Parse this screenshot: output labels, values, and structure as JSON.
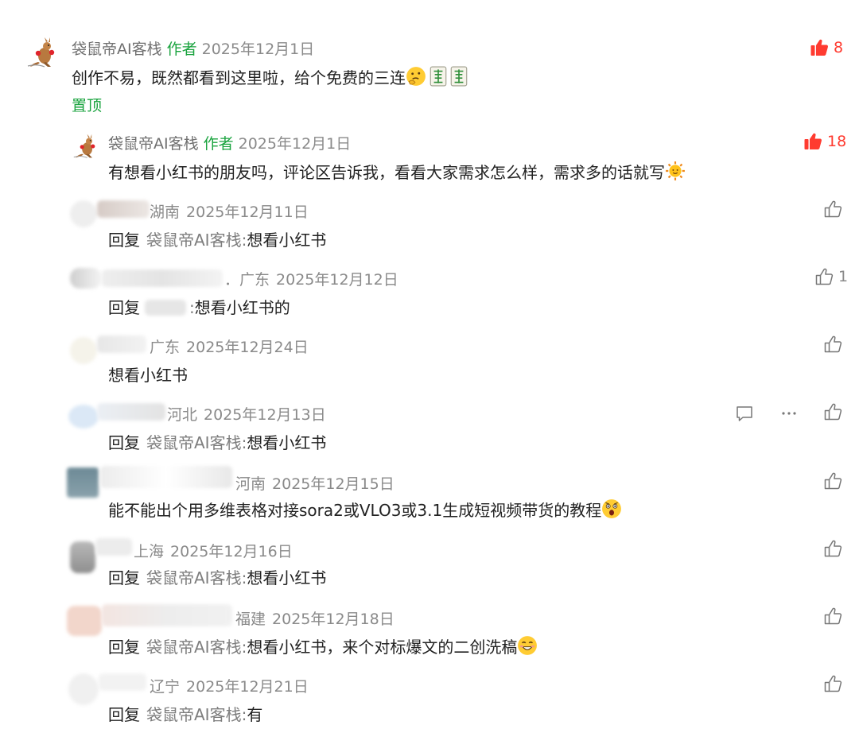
{
  "comments": [
    {
      "author": "袋鼠帝AI客栈",
      "author_tag": "作者",
      "date": "2025年12月1日",
      "text": "创作不易，既然都看到这里啦，给个免费的三连",
      "pinned": "置顶",
      "likes": "8"
    },
    {
      "author": "袋鼠帝AI客栈",
      "author_tag": "作者",
      "date": "2025年12月1日",
      "text": "有想看小红书的朋友吗，评论区告诉我，看看大家需求怎么样，需求多的话就写",
      "likes": "18"
    },
    {
      "location": "湖南",
      "date": "2025年12月11日",
      "reply_kw": "回复",
      "reply_to": "袋鼠帝AI客栈",
      "colon": ":",
      "text": "想看小红书"
    },
    {
      "location": "．广东",
      "date": "2025年12月12日",
      "reply_kw": "回复",
      "colon": ":",
      "text": "想看小红书的",
      "likes": "1"
    },
    {
      "location": "广东",
      "date": "2025年12月24日",
      "text": "想看小红书"
    },
    {
      "location": "河北",
      "date": "2025年12月13日",
      "reply_kw": "回复",
      "reply_to": "袋鼠帝AI客栈",
      "colon": ":",
      "text": "想看小红书"
    },
    {
      "location": "河南",
      "date": "2025年12月15日",
      "text": "能不能出个用多维表格对接sora2或VLO3或3.1生成短视频带货的教程"
    },
    {
      "location": "上海",
      "date": "2025年12月16日",
      "reply_kw": "回复",
      "reply_to": "袋鼠帝AI客栈",
      "colon": ":",
      "text": "想看小红书"
    },
    {
      "location": "福建",
      "date": "2025年12月18日",
      "reply_kw": "回复",
      "reply_to": "袋鼠帝AI客栈",
      "colon": ":",
      "text": "想看小红书，来个对标爆文的二创洗稿"
    },
    {
      "location": "辽宁",
      "date": "2025年12月21日",
      "reply_kw": "回复",
      "reply_to": "袋鼠帝AI客栈",
      "colon": ":",
      "text": "有"
    }
  ],
  "icons": {
    "like_active": "thumbs-up-filled-icon",
    "like": "thumbs-up-outline-icon",
    "comment": "comment-bubble-icon",
    "more": "more-dots-icon"
  },
  "colors": {
    "like_active": "#ff3b30",
    "author_tag": "#19a33e",
    "pinned": "#19a33e",
    "meta": "#8a8a8a"
  }
}
